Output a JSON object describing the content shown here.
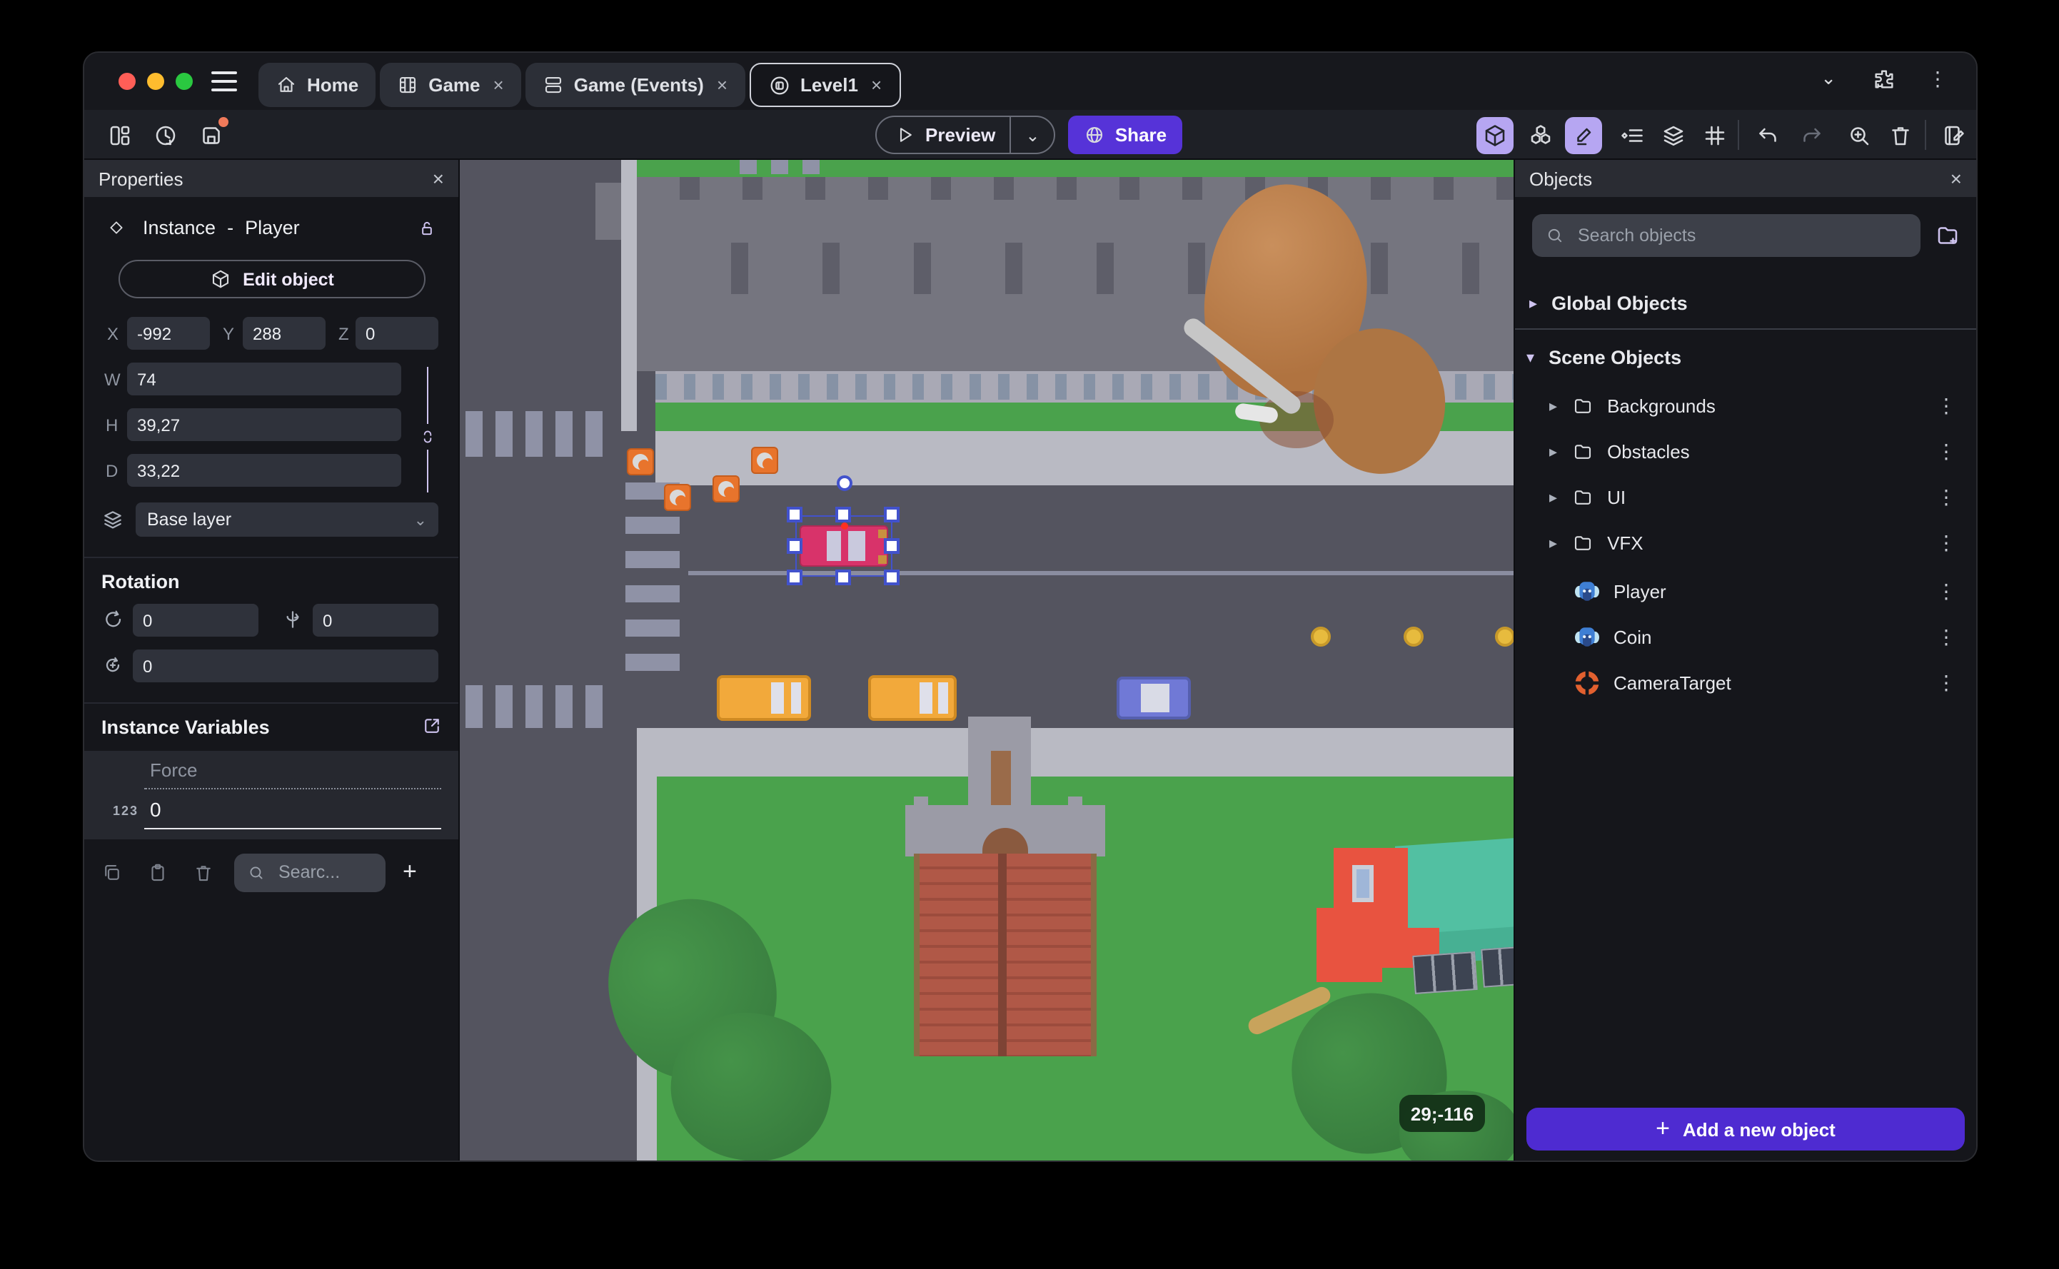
{
  "window": {
    "tabs": [
      {
        "label": "Home",
        "icon": "home-icon",
        "closable": false,
        "active": false
      },
      {
        "label": "Game",
        "icon": "film-icon",
        "closable": true,
        "active": false
      },
      {
        "label": "Game (Events)",
        "icon": "events-sheet-icon",
        "closable": true,
        "active": false
      },
      {
        "label": "Level1",
        "icon": "scene-icon",
        "closable": true,
        "active": true
      }
    ]
  },
  "toolbar": {
    "preview_label": "Preview",
    "share_label": "Share"
  },
  "properties_panel": {
    "title": "Properties",
    "instance_label": "Instance",
    "separator": "-",
    "object_name": "Player",
    "edit_object_label": "Edit object",
    "position": {
      "x_label": "X",
      "x_value": "-992",
      "y_label": "Y",
      "y_value": "288",
      "z_label": "Z",
      "z_value": "0"
    },
    "size": {
      "w_label": "W",
      "w_value": "74",
      "h_label": "H",
      "h_value": "39,27",
      "d_label": "D",
      "d_value": "33,22"
    },
    "layer_value": "Base layer",
    "rotation": {
      "title": "Rotation",
      "x_value": "0",
      "y_value": "0",
      "z_value": "0"
    },
    "instance_variables": {
      "title": "Instance Variables",
      "rows": [
        {
          "name": "Force",
          "type_badge": "123",
          "value": "0"
        }
      ],
      "search_placeholder": "Searc..."
    }
  },
  "canvas": {
    "cursor_coordinates": "29;-116"
  },
  "objects_panel": {
    "title": "Objects",
    "search_placeholder": "Search objects",
    "global_group_label": "Global Objects",
    "scene_group_label": "Scene Objects",
    "folders": [
      {
        "name": "Backgrounds"
      },
      {
        "name": "Obstacles"
      },
      {
        "name": "UI"
      },
      {
        "name": "VFX"
      }
    ],
    "objects": [
      {
        "name": "Player",
        "icon": "monkey-sprite-icon"
      },
      {
        "name": "Coin",
        "icon": "monkey-sprite-icon"
      },
      {
        "name": "CameraTarget",
        "icon": "camera-target-icon"
      }
    ],
    "add_button_label": "Add a new object"
  },
  "glyphs": {
    "close": "×",
    "kebab": "⋮",
    "caret_right": "▸",
    "caret_down": "▾",
    "plus": "+",
    "chevron_down": "⌄"
  },
  "colors": {
    "accent_purple": "#4e2bd1",
    "share_purple": "#5633d8",
    "active_tool_bg": "#b6a6f2",
    "selection_blue": "#4252cc",
    "unsaved_dot_orange": "#f07a5a",
    "traffic_red": "#ff5e57",
    "traffic_yellow": "#febc2e",
    "traffic_green": "#2ac840"
  }
}
